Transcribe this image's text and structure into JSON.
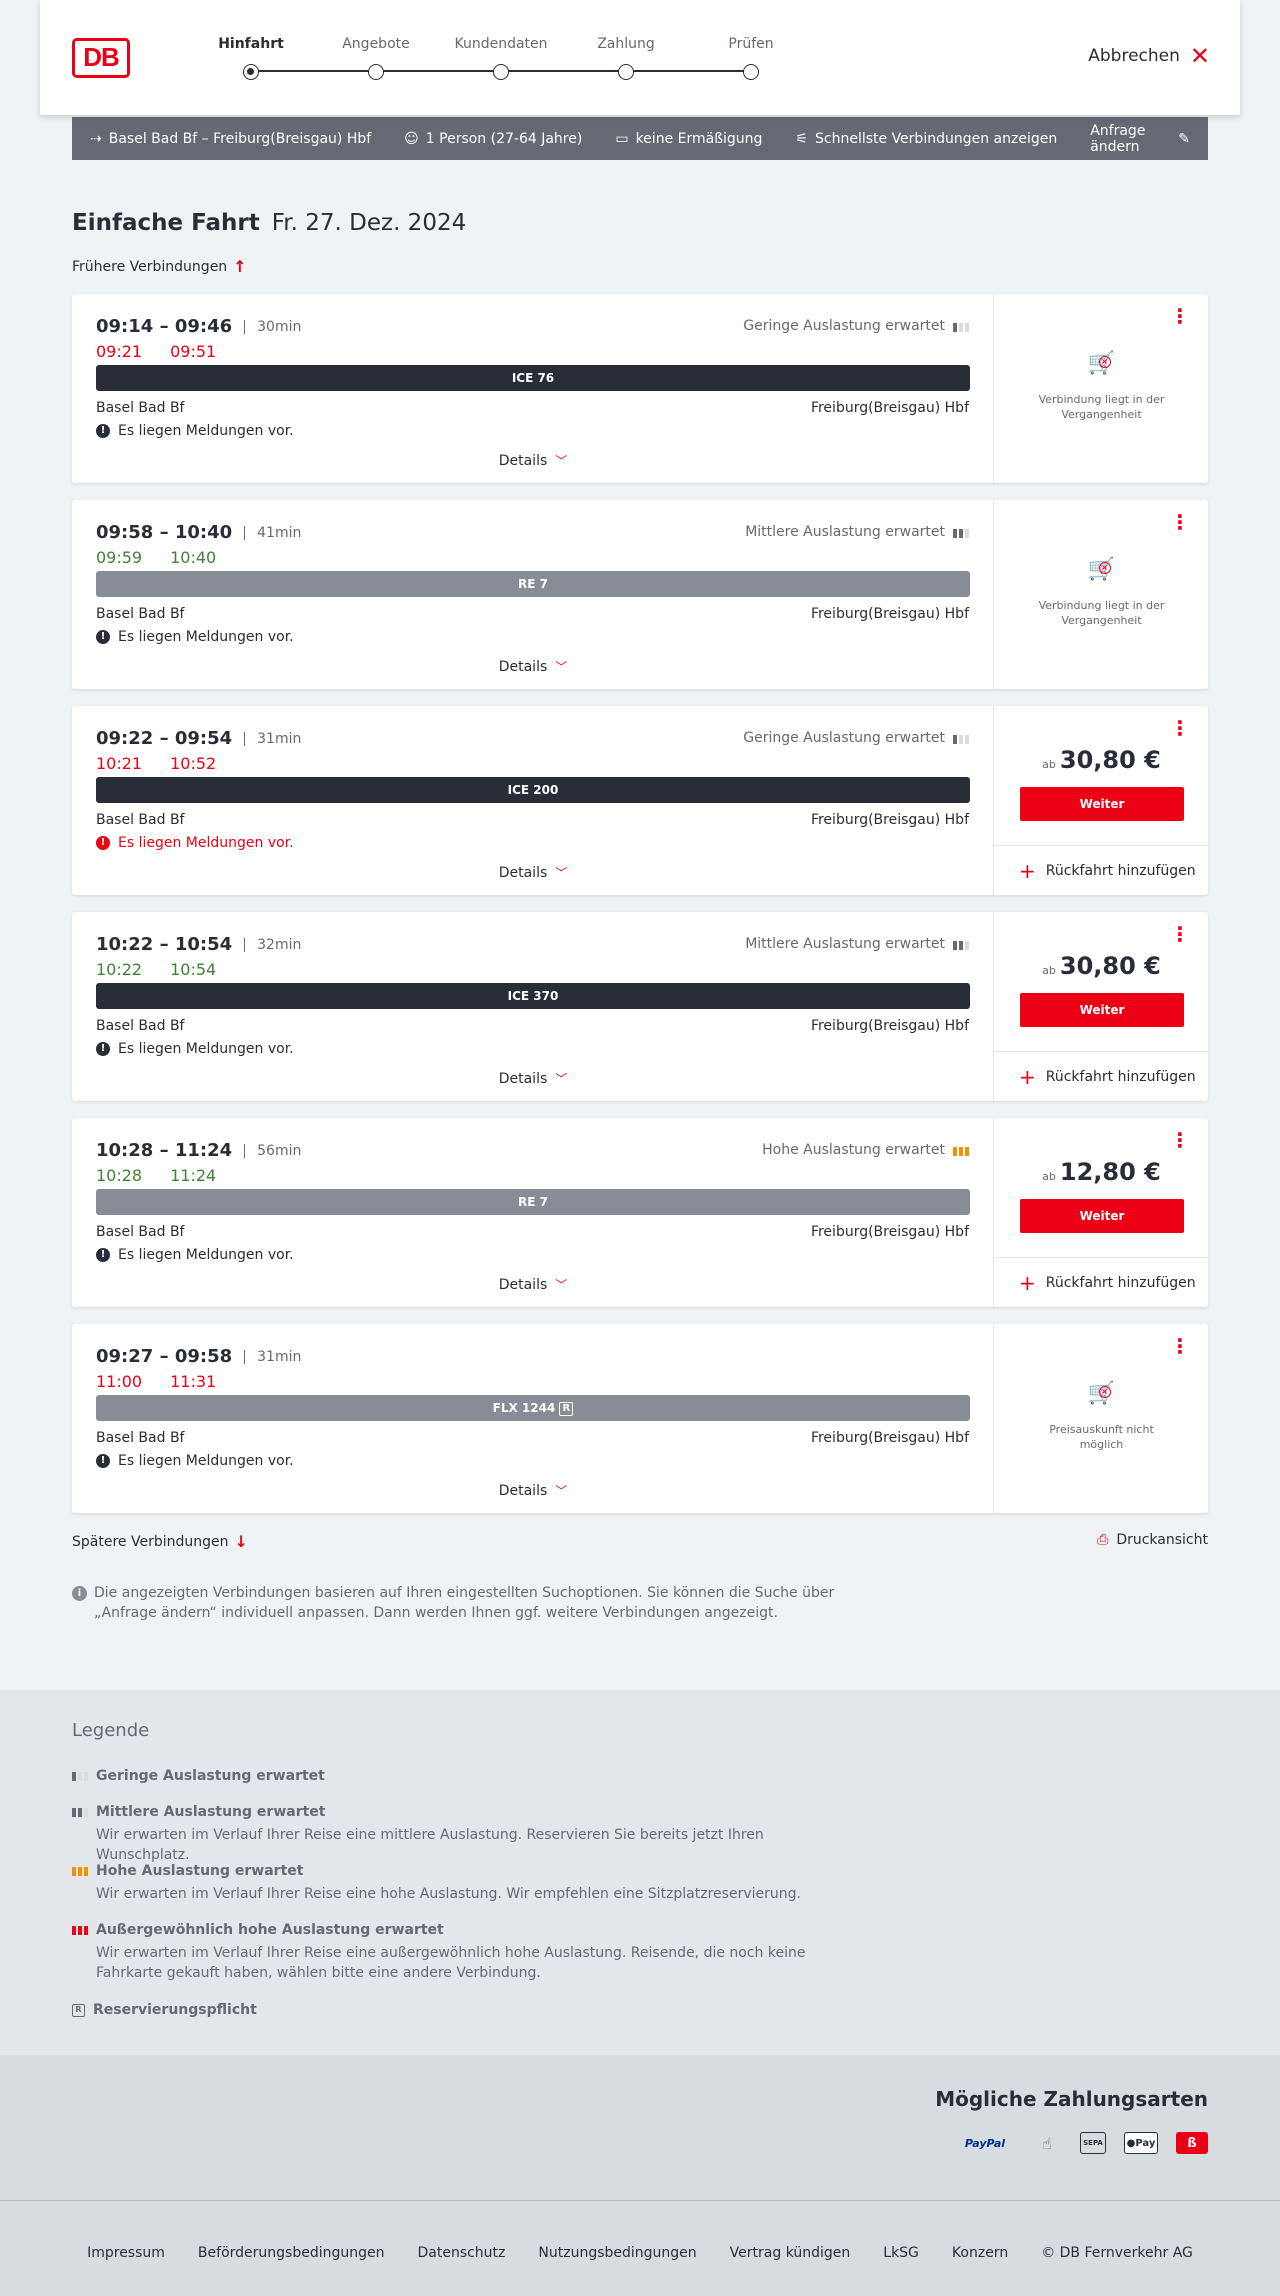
{
  "header": {
    "logo": "DB",
    "steps": [
      {
        "label": "Hinfahrt",
        "active": true
      },
      {
        "label": "Angebote",
        "active": false
      },
      {
        "label": "Kundendaten",
        "active": false
      },
      {
        "label": "Zahlung",
        "active": false
      },
      {
        "label": "Prüfen",
        "active": false
      }
    ],
    "cancel_label": "Abbrechen"
  },
  "filterbar": {
    "route": "Basel Bad Bf – Freiburg(Breisgau) Hbf",
    "passengers": "1 Person (27-64 Jahre)",
    "discount": "keine Ermäßigung",
    "fastest": "Schnellste Verbindungen anzeigen",
    "edit": "Anfrage ändern"
  },
  "page": {
    "title": "Einfache Fahrt",
    "date": "Fr. 27. Dez. 2024",
    "earlier": "Frühere Verbindungen",
    "later": "Spätere Verbindungen",
    "print": "Druckansicht",
    "info": "Die angezeigten Verbindungen basieren auf Ihren eingestellten Suchoptionen. Sie können die Suche über „Anfrage ändern“ individuell anpassen. Dann werden Ihnen ggf. weitere Verbindungen angezeigt."
  },
  "common": {
    "from": "Basel Bad Bf",
    "to": "Freiburg(Breisgau) Hbf",
    "message": "Es liegen Meldungen vor.",
    "details": "Details",
    "weiter": "Weiter",
    "ab": "ab",
    "return": "Rückfahrt hinzufügen"
  },
  "connections": [
    {
      "times": "09:14 – 09:46",
      "duration": "30min",
      "rt_dep": "09:21",
      "rt_arr": "09:51",
      "rt_status": "late",
      "load": "Geringe Auslastung erwartet",
      "load_level": 1,
      "train": "ICE 76",
      "train_style": "dark",
      "msg_red": false,
      "price": null,
      "status_text": "Verbindung liegt in der Vergangenheit"
    },
    {
      "times": "09:58 – 10:40",
      "duration": "41min",
      "rt_dep": "09:59",
      "rt_arr": "10:40",
      "rt_status": "ok",
      "load": "Mittlere Auslastung erwartet",
      "load_level": 2,
      "train": "RE 7",
      "train_style": "grey",
      "msg_red": false,
      "price": null,
      "status_text": "Verbindung liegt in der Vergangenheit"
    },
    {
      "times": "09:22 – 09:54",
      "duration": "31min",
      "rt_dep": "10:21",
      "rt_arr": "10:52",
      "rt_status": "late",
      "load": "Geringe Auslastung erwartet",
      "load_level": 1,
      "train": "ICE 200",
      "train_style": "dark",
      "msg_red": true,
      "price": "30,80 €",
      "status_text": null
    },
    {
      "times": "10:22 – 10:54",
      "duration": "32min",
      "rt_dep": "10:22",
      "rt_arr": "10:54",
      "rt_status": "ok",
      "load": "Mittlere Auslastung erwartet",
      "load_level": 2,
      "train": "ICE 370",
      "train_style": "dark",
      "msg_red": false,
      "price": "30,80 €",
      "status_text": null
    },
    {
      "times": "10:28 – 11:24",
      "duration": "56min",
      "rt_dep": "10:28",
      "rt_arr": "11:24",
      "rt_status": "ok",
      "load": "Hohe Auslastung erwartet",
      "load_level": 3,
      "train": "RE 7",
      "train_style": "grey",
      "msg_red": false,
      "price": "12,80 €",
      "status_text": null
    },
    {
      "times": "09:27 – 09:58",
      "duration": "31min",
      "rt_dep": "11:00",
      "rt_arr": "11:31",
      "rt_status": "late",
      "load": null,
      "load_level": 0,
      "train": "FLX 1244",
      "train_style": "grey",
      "train_badge": "R",
      "msg_red": false,
      "price": null,
      "status_text": "Preisauskunft nicht möglich"
    }
  ],
  "legend": {
    "title": "Legende",
    "items": [
      {
        "title": "Geringe Auslastung erwartet",
        "desc": "",
        "icon": "low"
      },
      {
        "title": "Mittlere Auslastung erwartet",
        "desc": "Wir erwarten im Verlauf Ihrer Reise eine mittlere Auslastung. Reservieren Sie bereits jetzt Ihren Wunschplatz.",
        "icon": "mid"
      },
      {
        "title": "Hohe Auslastung erwartet",
        "desc": "Wir erwarten im Verlauf Ihrer Reise eine hohe Auslastung. Wir empfehlen eine Sitzplatzreservierung.",
        "icon": "high"
      },
      {
        "title": "Außergewöhnlich hohe Auslastung erwartet",
        "desc": "Wir erwarten im Verlauf Ihrer Reise eine außergewöhnlich hohe Auslastung. Reisende, die noch keine Fahrkarte gekauft haben, wählen bitte eine andere Verbindung.",
        "icon": "xhigh"
      },
      {
        "title": "Reservierungspflicht",
        "desc": "",
        "icon": "R"
      }
    ]
  },
  "payment": {
    "title": "Mögliche Zahlungsarten",
    "paypal": "PayPal",
    "sepa": "SEPA",
    "apple": "Pay",
    "db": "ß"
  },
  "footer": {
    "links": [
      "Impressum",
      "Beförderungsbedingungen",
      "Datenschutz",
      "Nutzungsbedingungen",
      "Vertrag kündigen",
      "LkSG",
      "Konzern",
      "© DB Fernverkehr AG"
    ]
  },
  "colors": {
    "accent": "#ec0016",
    "late": "#ec0016",
    "ontime": "#408335",
    "high_load": "#f39200"
  }
}
